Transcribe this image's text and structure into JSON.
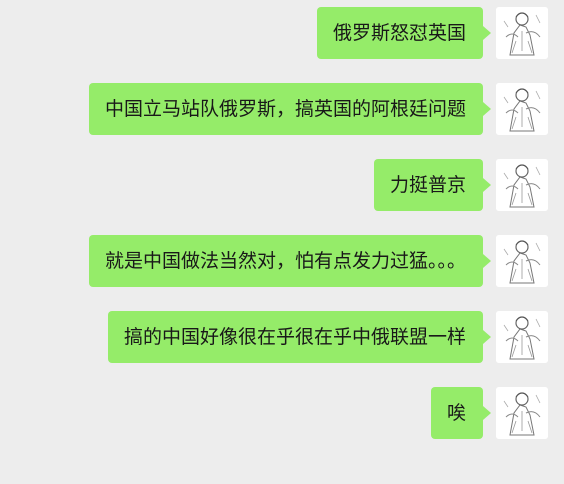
{
  "chat": {
    "messages": [
      {
        "text": "俄罗斯怒怼英国",
        "avatar_icon": "user-avatar-icon"
      },
      {
        "text": "中国立马站队俄罗斯，搞英国的阿根廷问题",
        "avatar_icon": "user-avatar-icon"
      },
      {
        "text": "力挺普京",
        "avatar_icon": "user-avatar-icon"
      },
      {
        "text": "就是中国做法当然对，怕有点发力过猛。。。",
        "avatar_icon": "user-avatar-icon"
      },
      {
        "text": "搞的中国好像很在乎很在乎中俄联盟一样",
        "avatar_icon": "user-avatar-icon"
      },
      {
        "text": "唉",
        "avatar_icon": "user-avatar-icon"
      }
    ]
  },
  "colors": {
    "background": "#ededed",
    "bubble": "#95ec69",
    "text": "#191919"
  }
}
